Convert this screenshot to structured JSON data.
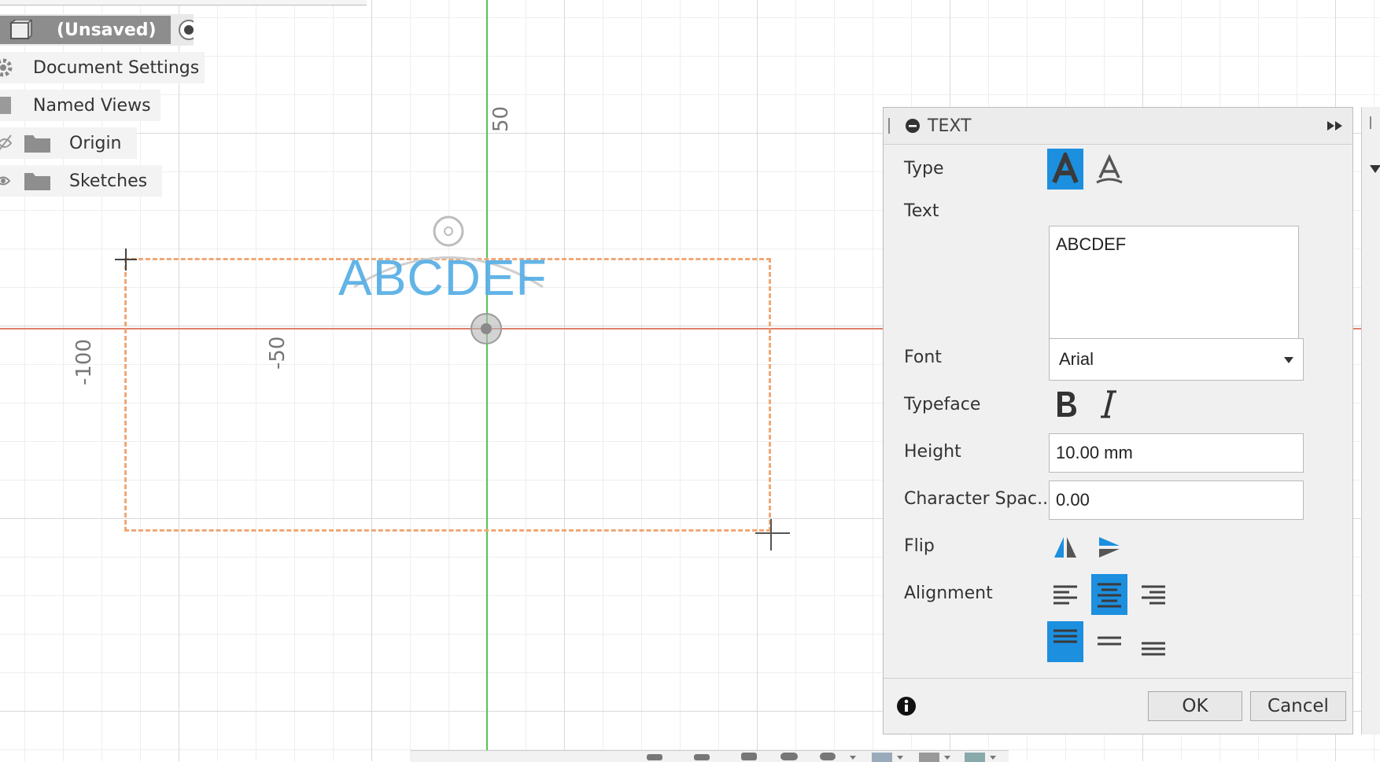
{
  "browser": {
    "document_label": "(Unsaved)",
    "items": [
      {
        "label": "Document Settings",
        "icon": "gear-icon"
      },
      {
        "label": "Named Views",
        "icon": "folder-icon"
      },
      {
        "label": "Origin",
        "icon": "folder-icon"
      },
      {
        "label": "Sketches",
        "icon": "folder-icon"
      }
    ]
  },
  "canvas": {
    "dimension_labels": [
      "50",
      "-100",
      "-50"
    ],
    "sketch_text": "ABCDEF",
    "colors": {
      "x_axis": "#e07f6b",
      "y_axis": "#54c554",
      "selection": "#f0a877",
      "sketch_text": "#5ab0e6"
    }
  },
  "dialog": {
    "title": "TEXT",
    "labels": {
      "type": "Type",
      "text": "Text",
      "font": "Font",
      "typeface": "Typeface",
      "height": "Height",
      "char_spacing": "Character Spac...",
      "flip": "Flip",
      "alignment": "Alignment"
    },
    "text_value": "ABCDEF",
    "font_value": "Arial",
    "height_value": "10.00 mm",
    "char_spacing_value": "0.00",
    "ok_label": "OK",
    "cancel_label": "Cancel",
    "accent_color": "#1c8fdf"
  }
}
